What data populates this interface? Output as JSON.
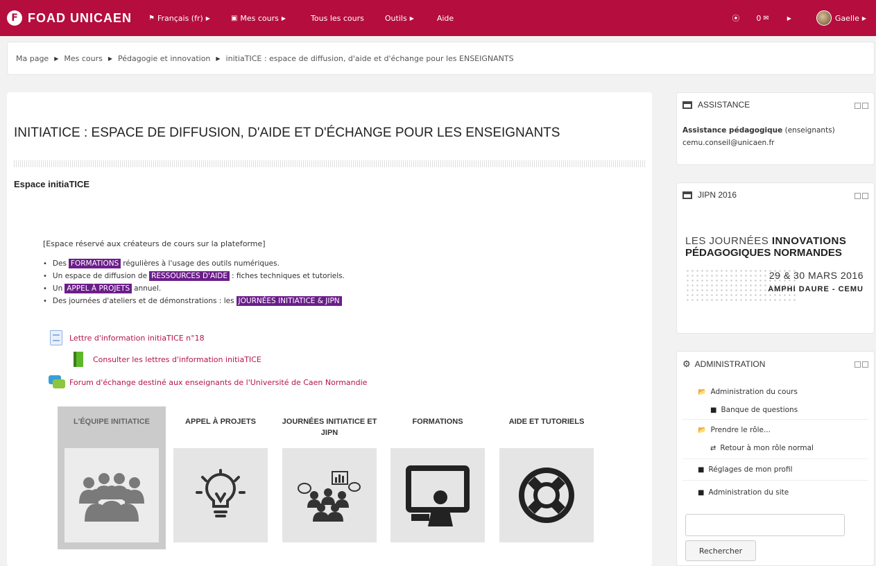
{
  "navbar": {
    "brand": "FOAD UNICAEN",
    "brand_logo": "F",
    "items": [
      {
        "label": "Français (fr)",
        "icon": "flag-icon"
      },
      {
        "label": "Mes cours",
        "icon": "briefcase-icon"
      },
      {
        "label": "Tous les cours"
      },
      {
        "label": "Outils"
      },
      {
        "label": "Aide"
      }
    ],
    "notif_count": "0",
    "user": "Gaelle",
    "accent_color": "#b50d3e"
  },
  "breadcrumb": [
    "Ma page",
    "Mes cours",
    "Pédagogie et innovation",
    "initiaTICE : espace de diffusion, d'aide et d'échange pour les ENSEIGNANTS"
  ],
  "main": {
    "title": "INITIATICE : ESPACE DE DIFFUSION, D'AIDE ET D'ÉCHANGE POUR LES ENSEIGNANTS",
    "section_title": "Espace initiaTICE",
    "intro": "[Espace réservé aux créateurs de cours sur la plateforme]",
    "bullets": [
      {
        "before": "Des",
        "tag": "FORMATIONS",
        "after": "régulières à l'usage des outils numériques."
      },
      {
        "before": "Un espace de diffusion de",
        "tag": "RESSOURCES D'AIDE",
        "after": ": fiches techniques et tutoriels."
      },
      {
        "before": "Un",
        "tag": "APPEL À PROJETS",
        "after": "annuel."
      },
      {
        "before": "Des journées d'ateliers et de démonstrations : les",
        "tag": "JOURNÉES INITIATICE & JIPN",
        "after": ""
      }
    ],
    "resources": {
      "newsletter": "Lettre d'information initiaTICE n°18",
      "book": "Consulter les lettres d'information initiaTICE",
      "forum": "Forum d'échange destiné aux enseignants de l'Université de Caen Normandie"
    },
    "tiles": [
      {
        "label": "L'ÉQUIPE INITIATICE",
        "icon": "team-icon"
      },
      {
        "label": "APPEL À PROJETS",
        "icon": "lightbulb-icon"
      },
      {
        "label": "JOURNÉES INITIATICE ET JIPN",
        "icon": "audience-icon"
      },
      {
        "label": "FORMATIONS",
        "icon": "presentation-icon"
      },
      {
        "label": "AIDE ET TUTORIELS",
        "icon": "lifebuoy-icon"
      }
    ]
  },
  "sidebar": {
    "assistance": {
      "title": "ASSISTANCE",
      "label_bold": "Assistance pédagogique",
      "label_rest": "(enseignants)",
      "email": "cemu.conseil@unicaen.fr"
    },
    "jipn": {
      "title": "JIPN 2016",
      "line1_light": "LES JOURNÉES",
      "line1_bold": "INNOVATIONS",
      "line2": "PÉDAGOGIQUES NORMANDES",
      "dates": "29 & 30 MARS 2016",
      "location": "AMPHI DAURE - CEMU"
    },
    "admin": {
      "title": "ADMINISTRATION",
      "items": [
        "Administration du cours",
        "Banque de questions",
        "Prendre le rôle...",
        "Retour à mon rôle normal",
        "Réglages de mon profil",
        "Administration du site"
      ],
      "search_button": "Rechercher"
    }
  }
}
